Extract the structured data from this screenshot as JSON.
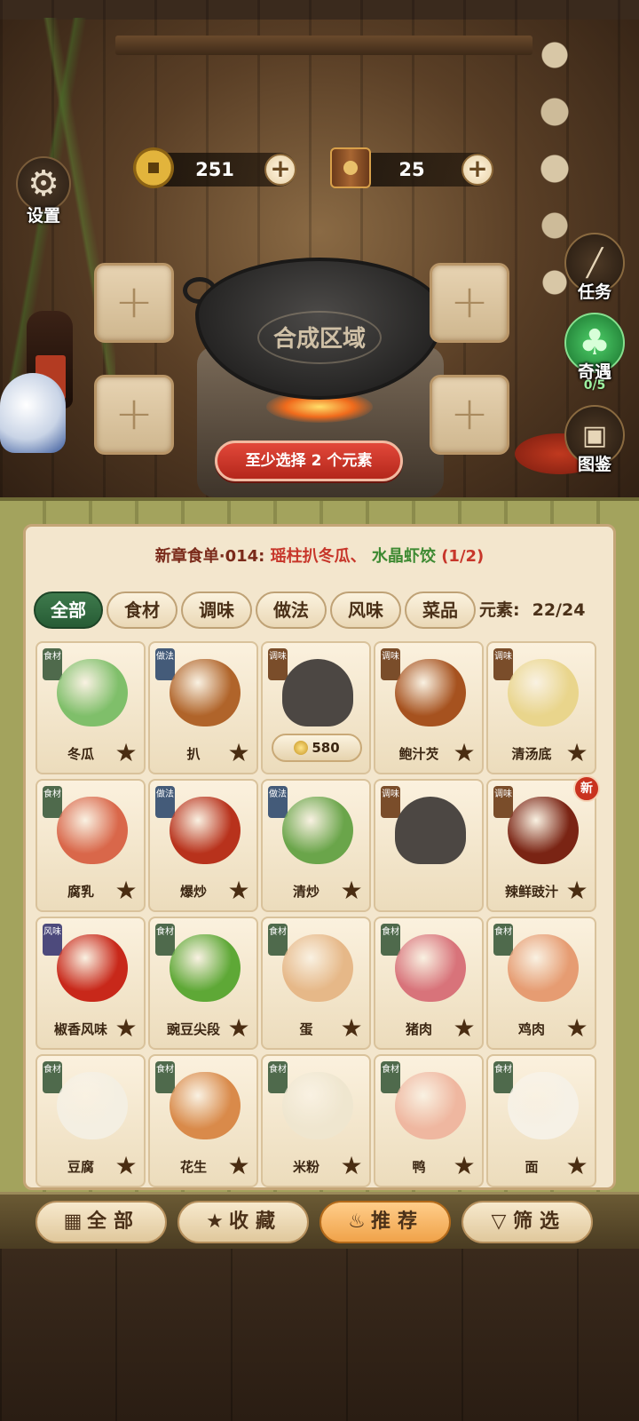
{
  "resources": {
    "coins": "251",
    "books": "25",
    "coin_plus": "+",
    "book_plus": "+"
  },
  "settings": {
    "label": "设置"
  },
  "side": {
    "task_label": "任务",
    "luck_label": "奇遇",
    "luck_count": "0/5",
    "dex_label": "图鉴"
  },
  "synth": {
    "wok_label": "合成区域",
    "slot_symbol": "+",
    "hint": "至少选择 2 个元素"
  },
  "recipe": {
    "prefix": "新章食单·014:",
    "dish_a": "瑶柱扒冬瓜、",
    "dish_b": "水晶虾饺",
    "progress": "(1/2)"
  },
  "tabs": [
    "全部",
    "食材",
    "调味",
    "做法",
    "风味",
    "菜品"
  ],
  "element_count": {
    "label": "元素:",
    "value": "22/24"
  },
  "items": [
    {
      "name": "冬瓜",
      "tag": "食材",
      "kind": "ing",
      "color": "#7fbf6a"
    },
    {
      "name": "扒",
      "tag": "做法",
      "kind": "met",
      "color": "#b0642a"
    },
    {
      "name": "",
      "tag": "调味",
      "kind": "sea",
      "price": "580",
      "locked": true
    },
    {
      "name": "鲍汁芡",
      "tag": "调味",
      "kind": "sea",
      "color": "#a6521f"
    },
    {
      "name": "清汤底",
      "tag": "调味",
      "kind": "sea",
      "color": "#e9d58c"
    },
    {
      "name": "腐乳",
      "tag": "食材",
      "kind": "ing",
      "color": "#d9674a"
    },
    {
      "name": "爆炒",
      "tag": "做法",
      "kind": "met",
      "color": "#b8321c"
    },
    {
      "name": "清炒",
      "tag": "做法",
      "kind": "met",
      "color": "#6aa54a"
    },
    {
      "name": "",
      "tag": "调味",
      "kind": "sea",
      "locked": true
    },
    {
      "name": "辣鲜豉汁",
      "tag": "调味",
      "kind": "sea",
      "color": "#7a2414",
      "new": "新"
    },
    {
      "name": "椒香风味",
      "tag": "风味",
      "kind": "fla",
      "color": "#c8281a"
    },
    {
      "name": "豌豆尖段",
      "tag": "食材",
      "kind": "ing",
      "color": "#5ea836"
    },
    {
      "name": "蛋",
      "tag": "食材",
      "kind": "ing",
      "color": "#e6b888"
    },
    {
      "name": "猪肉",
      "tag": "食材",
      "kind": "ing",
      "color": "#d8737a"
    },
    {
      "name": "鸡肉",
      "tag": "食材",
      "kind": "ing",
      "color": "#e69c72"
    },
    {
      "name": "豆腐",
      "tag": "食材",
      "kind": "ing",
      "color": "#f4efe2"
    },
    {
      "name": "花生",
      "tag": "食材",
      "kind": "ing",
      "color": "#d98a4a"
    },
    {
      "name": "米粉",
      "tag": "食材",
      "kind": "ing",
      "color": "#efe6cf"
    },
    {
      "name": "鸭",
      "tag": "食材",
      "kind": "ing",
      "color": "#efb7a0"
    },
    {
      "name": "面",
      "tag": "食材",
      "kind": "ing",
      "color": "#f6f1e6"
    }
  ],
  "bottom": {
    "all": "全部",
    "fav": "收藏",
    "rec": "推荐",
    "filter": "筛选"
  },
  "colors": {
    "accent_green": "#2f6a3e",
    "hint_red": "#c7362a",
    "panel_bg": "#f3e6cd"
  }
}
